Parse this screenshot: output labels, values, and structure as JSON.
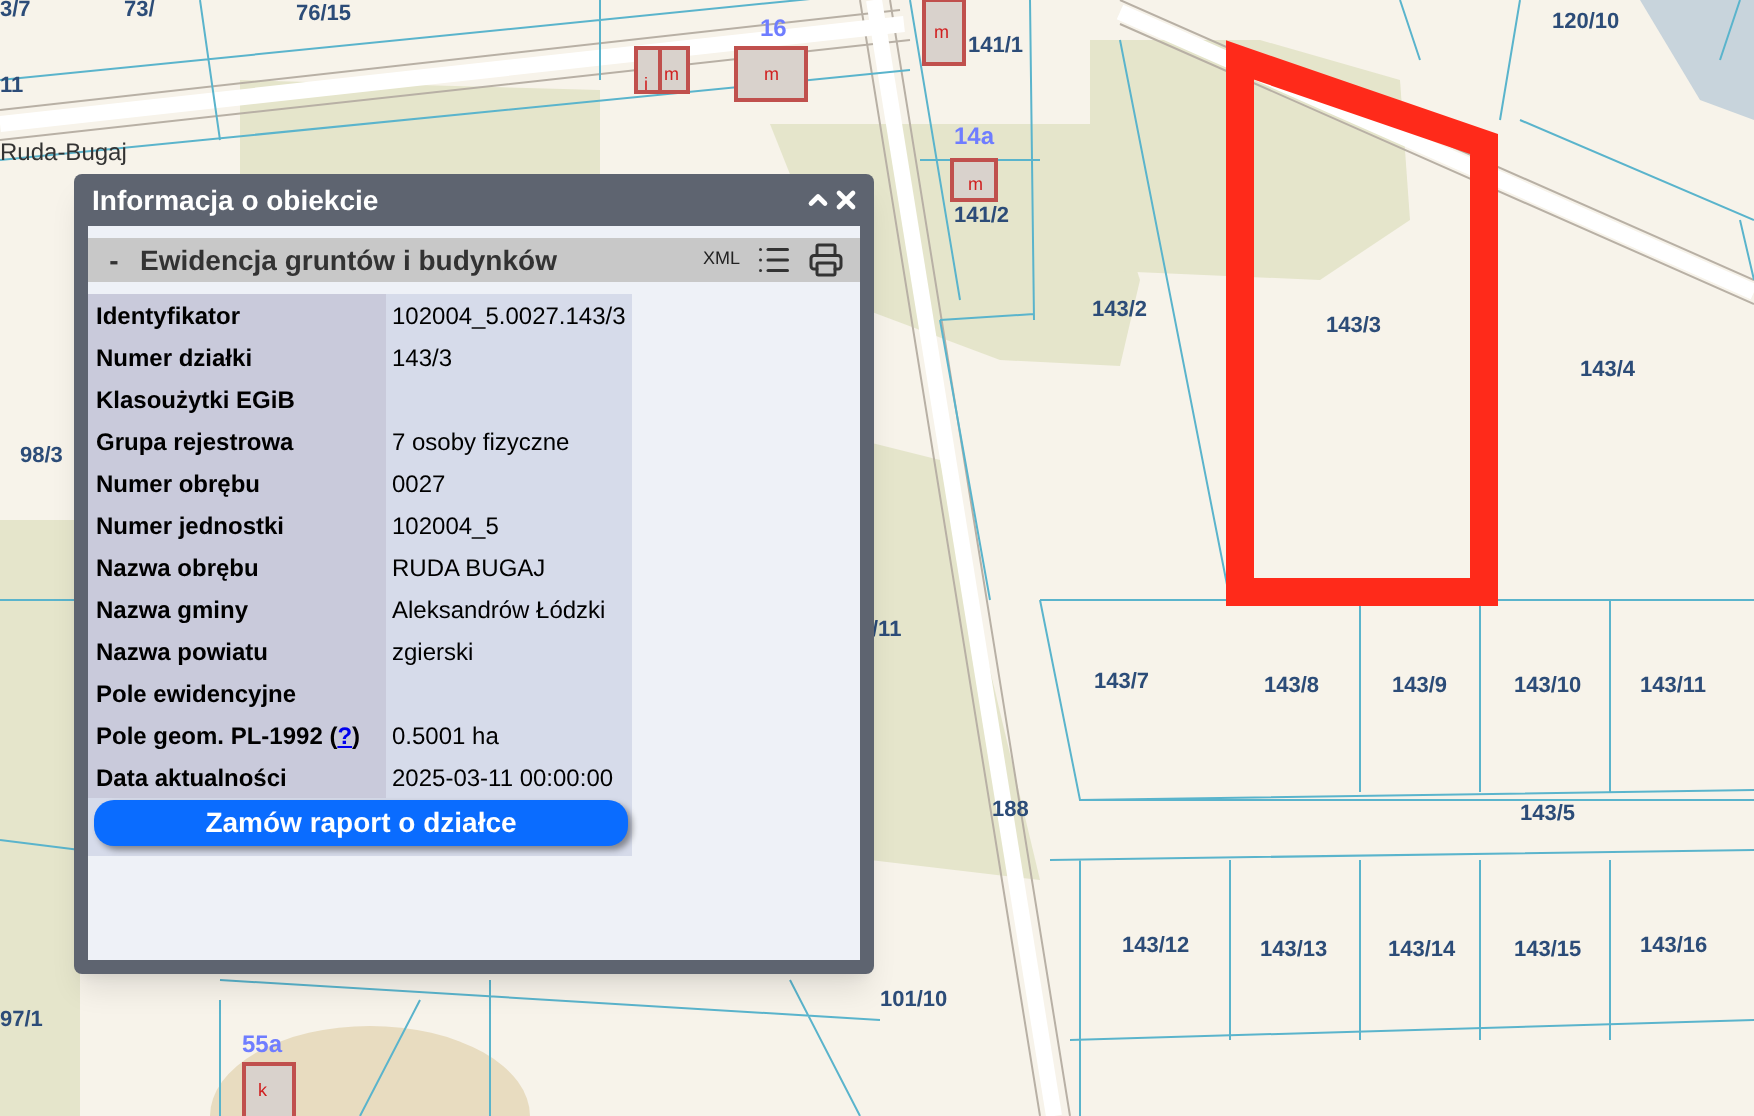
{
  "map": {
    "labels": [
      {
        "text": "3/7",
        "kind": "parcel"
      },
      {
        "text": "73/",
        "kind": "parcel"
      },
      {
        "text": "76/15",
        "kind": "parcel"
      },
      {
        "text": "11",
        "kind": "parcel"
      },
      {
        "text": "16",
        "kind": "address"
      },
      {
        "text": "m",
        "kind": "building"
      },
      {
        "text": "i",
        "kind": "building"
      },
      {
        "text": "m",
        "kind": "building"
      },
      {
        "text": "Ruda-Bugaj",
        "kind": "place"
      },
      {
        "text": "141/1",
        "kind": "parcel"
      },
      {
        "text": "m",
        "kind": "building"
      },
      {
        "text": "14a",
        "kind": "address"
      },
      {
        "text": "m",
        "kind": "building"
      },
      {
        "text": "141/2",
        "kind": "parcel"
      },
      {
        "text": "120/10",
        "kind": "parcel"
      },
      {
        "text": "143/2",
        "kind": "parcel"
      },
      {
        "text": "143/3",
        "kind": "parcel"
      },
      {
        "text": "143/4",
        "kind": "parcel"
      },
      {
        "text": "98/3",
        "kind": "parcel"
      },
      {
        "text": "/11",
        "kind": "parcel"
      },
      {
        "text": "143/7",
        "kind": "parcel"
      },
      {
        "text": "143/8",
        "kind": "parcel"
      },
      {
        "text": "143/9",
        "kind": "parcel"
      },
      {
        "text": "143/10",
        "kind": "parcel"
      },
      {
        "text": "143/11",
        "kind": "parcel"
      },
      {
        "text": "188",
        "kind": "parcel"
      },
      {
        "text": "143/5",
        "kind": "parcel"
      },
      {
        "text": "143/12",
        "kind": "parcel"
      },
      {
        "text": "143/13",
        "kind": "parcel"
      },
      {
        "text": "143/14",
        "kind": "parcel"
      },
      {
        "text": "143/15",
        "kind": "parcel"
      },
      {
        "text": "143/16",
        "kind": "parcel"
      },
      {
        "text": "101/10",
        "kind": "parcel"
      },
      {
        "text": "97/1",
        "kind": "parcel"
      },
      {
        "text": "55a",
        "kind": "address"
      },
      {
        "text": "k",
        "kind": "building"
      }
    ]
  },
  "popup": {
    "title": "Informacja o obiekcie",
    "section": {
      "toggle": "-",
      "title": "Ewidencja gruntów i budynków",
      "xml": "XML"
    },
    "rows": [
      {
        "label": "Identyfikator",
        "value": "102004_5.0027.143/3"
      },
      {
        "label": "Numer działki",
        "value": "143/3"
      },
      {
        "label": "Klasoużytki EGiB"
      },
      {
        "label": "Grupa rejestrowa",
        "value": "7 osoby fizyczne"
      },
      {
        "label": "Numer obrębu",
        "value": "0027"
      },
      {
        "label": "Numer jednostki",
        "value": "102004_5"
      },
      {
        "label": "Nazwa obrębu",
        "value": "RUDA BUGAJ"
      },
      {
        "label": "Nazwa gminy",
        "value": "Aleksandrów Łódzki"
      },
      {
        "label": "Nazwa powiatu",
        "value": "zgierski"
      },
      {
        "label": "Pole ewidencyjne"
      },
      {
        "label": "Pole geom. PL-1992 (",
        "link": "?",
        "label_end": ")",
        "value": "0.5001 ha"
      },
      {
        "label": "Data aktualności",
        "value": "2025-03-11 00:00:00"
      }
    ],
    "button": "Zamów raport o działce"
  }
}
